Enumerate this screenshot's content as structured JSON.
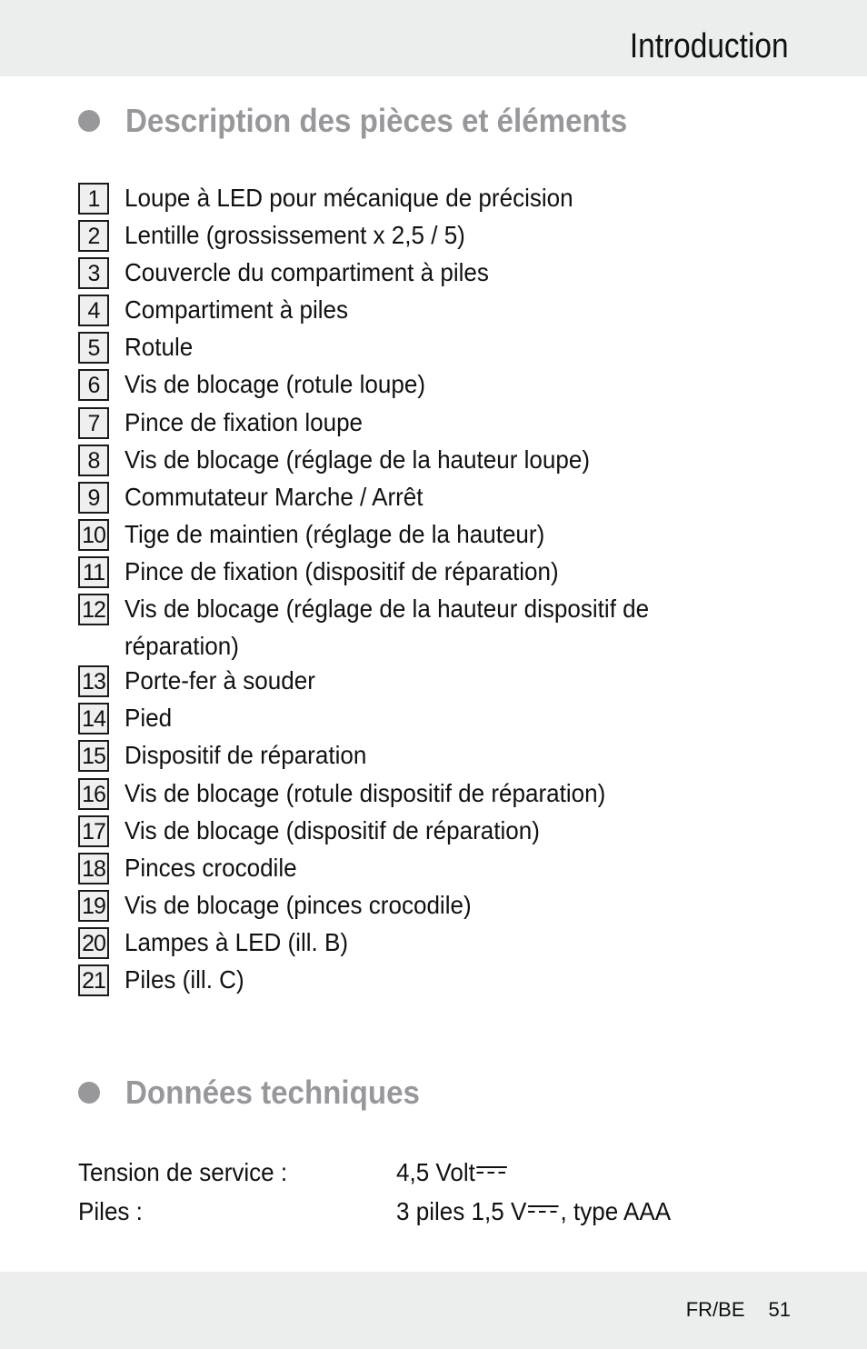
{
  "header": {
    "title": "Introduction"
  },
  "sections": {
    "parts": {
      "heading": "Description des pièces et éléments",
      "items": [
        {
          "num": "1",
          "label": "Loupe à LED pour mécanique de précision"
        },
        {
          "num": "2",
          "label": "Lentille (grossissement x 2,5 / 5)"
        },
        {
          "num": "3",
          "label": "Couvercle du compartiment à piles"
        },
        {
          "num": "4",
          "label": "Compartiment à piles"
        },
        {
          "num": "5",
          "label": "Rotule"
        },
        {
          "num": "6",
          "label": "Vis de blocage (rotule loupe)"
        },
        {
          "num": "7",
          "label": "Pince de fixation loupe"
        },
        {
          "num": "8",
          "label": "Vis de blocage (réglage de la hauteur loupe)"
        },
        {
          "num": "9",
          "label": "Commutateur Marche / Arrêt"
        },
        {
          "num": "10",
          "label": "Tige de maintien (réglage de la hauteur)"
        },
        {
          "num": "11",
          "label": "Pince de fixation (dispositif de réparation)"
        },
        {
          "num": "12",
          "label": "Vis de blocage (réglage de la hauteur dispositif de réparation)"
        },
        {
          "num": "13",
          "label": "Porte-fer à souder"
        },
        {
          "num": "14",
          "label": "Pied"
        },
        {
          "num": "15",
          "label": "Dispositif de réparation"
        },
        {
          "num": "16",
          "label": "Vis de blocage (rotule dispositif de réparation)"
        },
        {
          "num": "17",
          "label": "Vis de blocage (dispositif de réparation)"
        },
        {
          "num": "18",
          "label": "Pinces crocodile"
        },
        {
          "num": "19",
          "label": "Vis de blocage (pinces crocodile)"
        },
        {
          "num": "20",
          "label": "Lampes à LED (ill. B)"
        },
        {
          "num": "21",
          "label": "Piles (ill. C)"
        }
      ]
    },
    "specs": {
      "heading": "Données techniques",
      "rows": [
        {
          "label": "Tension de service :",
          "value_before": "4,5 Volt",
          "symbol": "dc-current-symbol",
          "value_after": ""
        },
        {
          "label": "Piles :",
          "value_before": "3 piles 1,5 V",
          "symbol": "dc-current-symbol",
          "value_after": ", type AAA"
        }
      ]
    }
  },
  "footer": {
    "locale": "FR/BE",
    "page_number": "51"
  }
}
